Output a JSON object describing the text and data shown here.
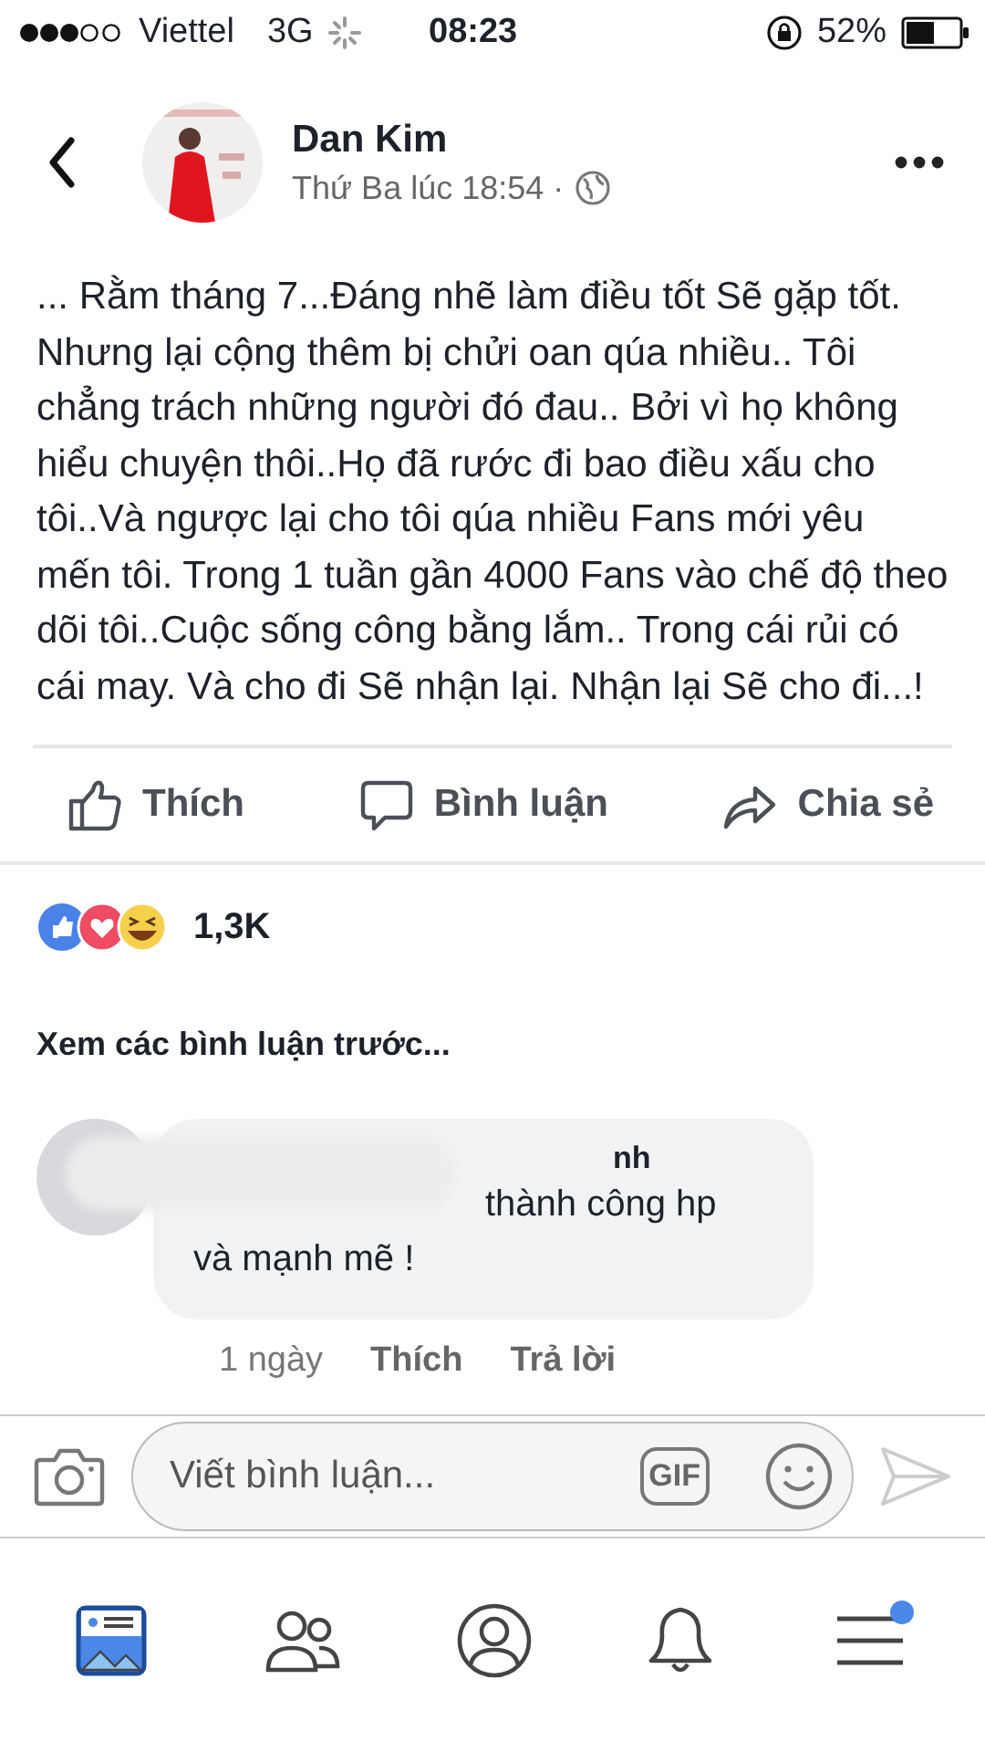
{
  "status_bar": {
    "carrier": "Viettel",
    "network": "3G",
    "time": "08:23",
    "battery": "52%"
  },
  "post": {
    "author": "Dan Kim",
    "timestamp": "Thứ Ba lúc 18:54 ·",
    "text": "... Rằm tháng 7...Đáng nhẽ làm điều tốt Sẽ gặp tốt. Nhưng lại cộng thêm bị chửi oan qúa nhiều.. Tôi chẳng trách những người đó đau.. Bởi vì họ không hiểu chuyện thôi..Họ đã rước đi bao điều xấu cho tôi..Và ngược lại cho tôi qúa nhiều Fans mới yêu mến tôi. Trong 1 tuần gần 4000 Fans vào chế độ theo dõi tôi..Cuộc sống công bằng lắm.. Trong cái rủi có cái may. Và cho đi Sẽ nhận lại. Nhận lại Sẽ cho đi...!",
    "actions": [
      {
        "kind": "like",
        "label": "Thích"
      },
      {
        "kind": "comment",
        "label": "Bình luận"
      },
      {
        "kind": "share",
        "label": "Chia sẻ"
      }
    ],
    "reaction_count": "1,3K"
  },
  "previous_comments_link": "Xem các bình luận trước...",
  "comment": {
    "author": "nh",
    "text_line_1": "thành công hp",
    "text_line_2": "và mạnh mẽ !",
    "time": "1 ngày",
    "like": "Thích",
    "reply": "Trả lời"
  },
  "composer": {
    "placeholder": "Viết bình luận...",
    "gif_label": "GIF"
  },
  "tab_bar": [
    {
      "kind": "feed",
      "selected": true,
      "badge": false
    },
    {
      "kind": "friends",
      "selected": false,
      "badge": false
    },
    {
      "kind": "profile",
      "selected": false,
      "badge": false
    },
    {
      "kind": "notifications",
      "selected": false,
      "badge": false
    },
    {
      "kind": "menu",
      "selected": false,
      "badge": true
    }
  ]
}
